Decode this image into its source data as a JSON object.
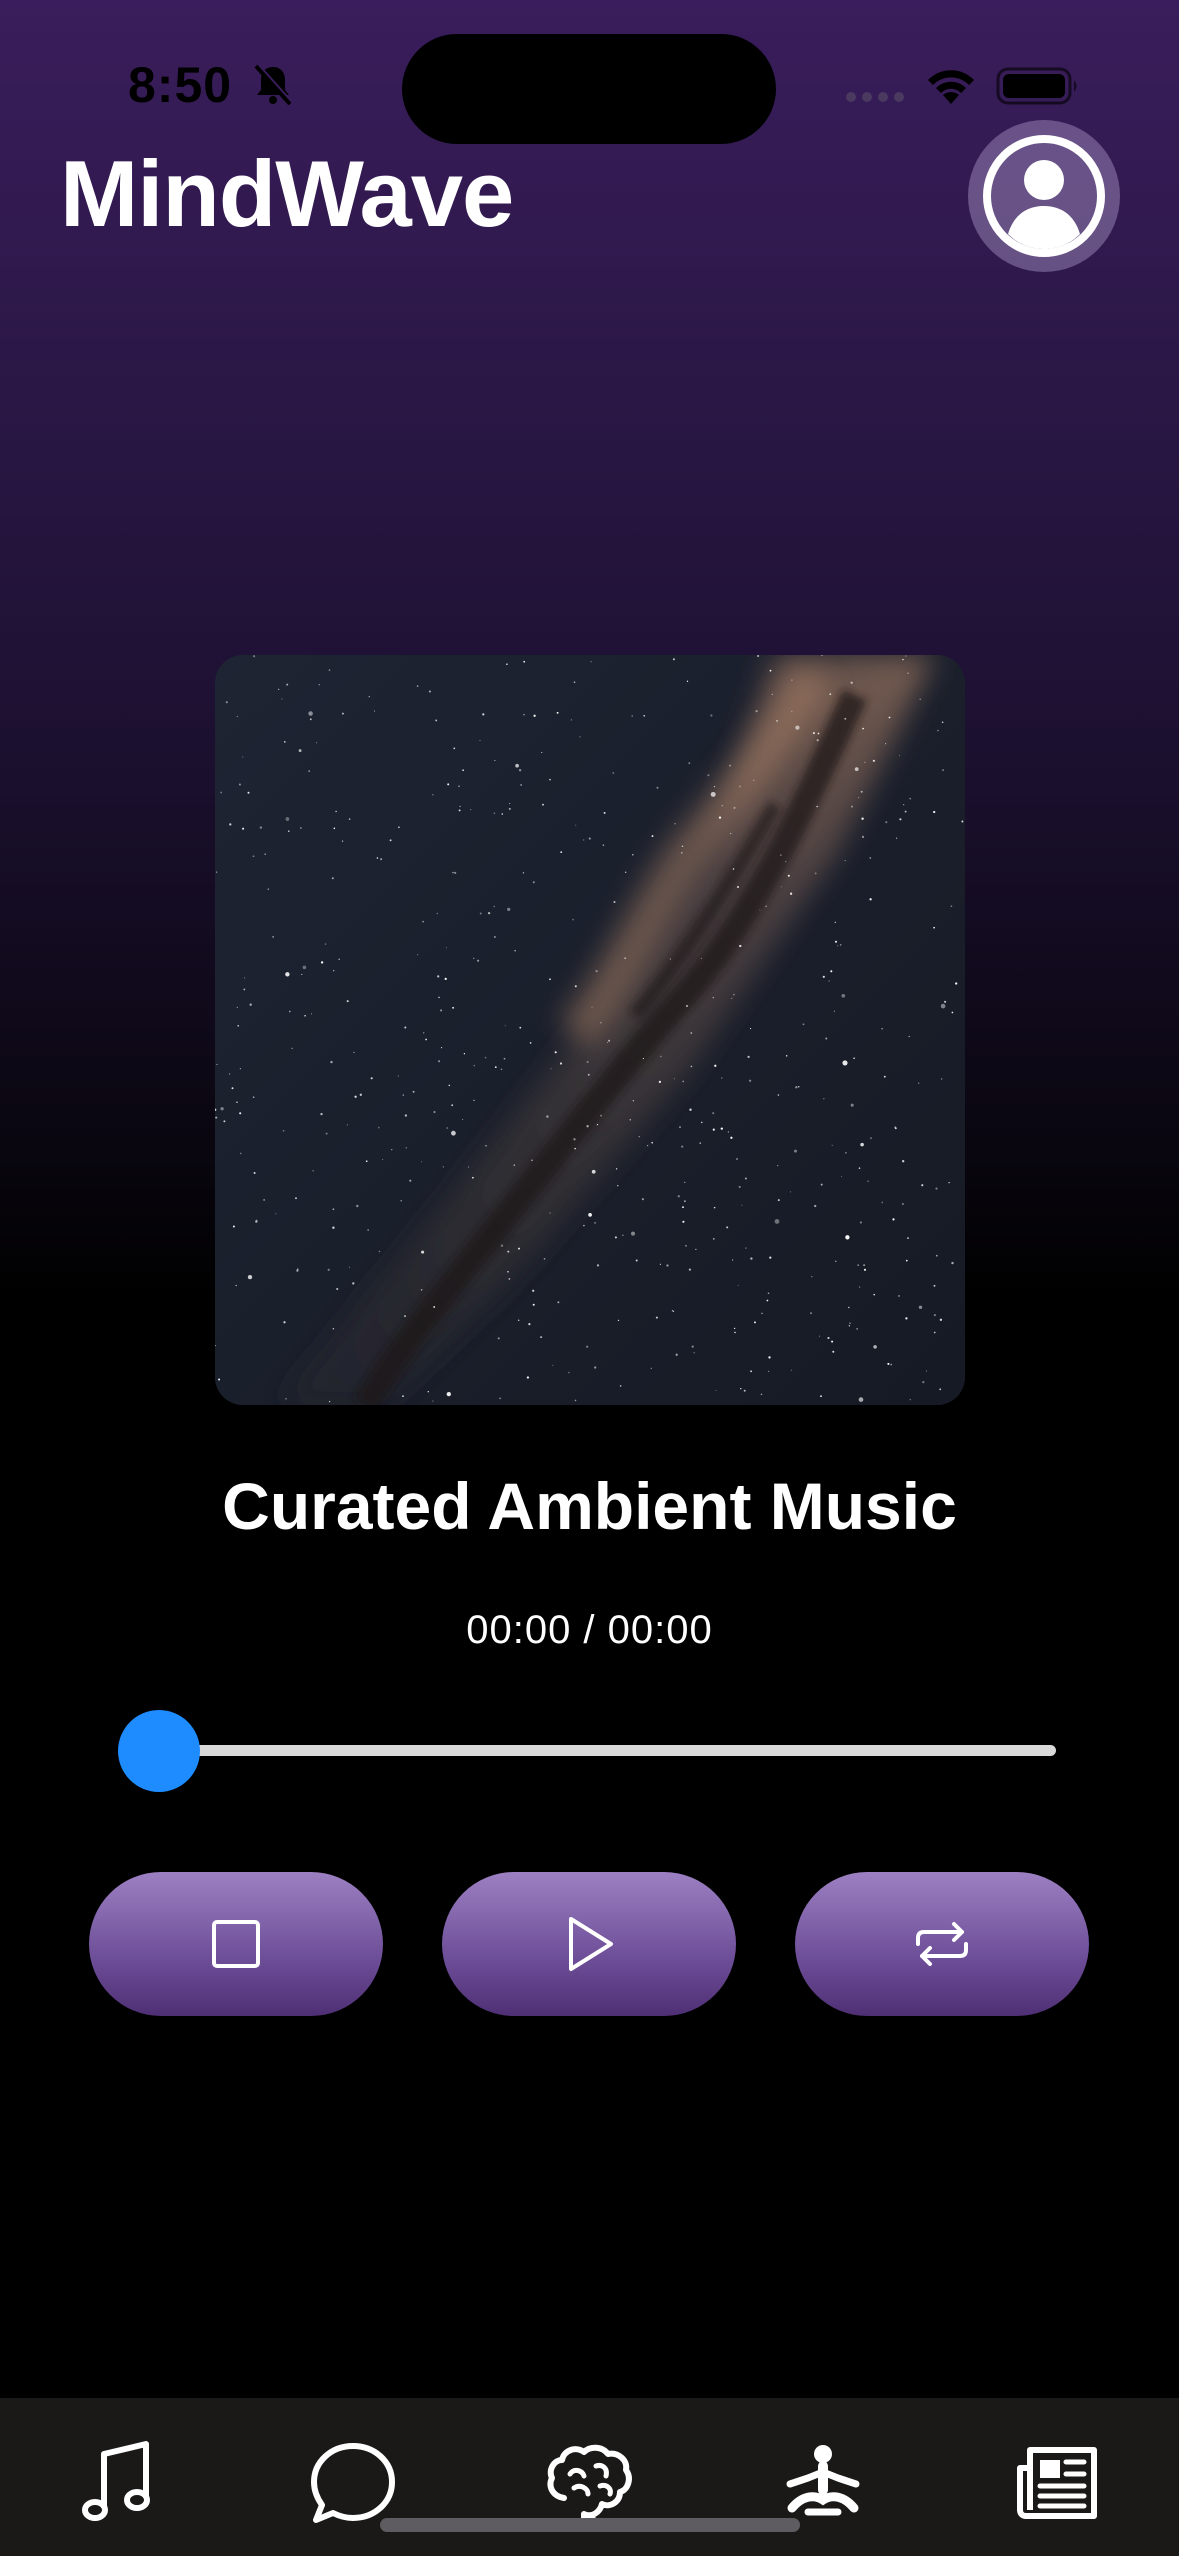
{
  "status_bar": {
    "time": "8:50"
  },
  "header": {
    "title": "MindWave",
    "profile_icon": "person-circle-icon"
  },
  "player": {
    "artwork_icon": "milky-way-artwork",
    "track_title": "Curated Ambient Music",
    "time_readout": "00:00 / 00:00",
    "progress": 0,
    "controls": [
      {
        "name": "stop",
        "icon": "stop-icon"
      },
      {
        "name": "play",
        "icon": "play-icon"
      },
      {
        "name": "repeat",
        "icon": "repeat-icon"
      }
    ]
  },
  "tab_bar": {
    "items": [
      {
        "name": "music",
        "icon": "music-note-icon"
      },
      {
        "name": "chat",
        "icon": "chat-bubble-icon"
      },
      {
        "name": "brain",
        "icon": "brain-icon"
      },
      {
        "name": "meditate",
        "icon": "meditation-icon"
      },
      {
        "name": "news",
        "icon": "newspaper-icon"
      }
    ]
  },
  "colors": {
    "accent": "#1e8cff",
    "button_purple": "#6d4e98",
    "background_top": "#3a1d5c",
    "background_bottom": "#000000",
    "tab_bar": "#1b1818"
  }
}
